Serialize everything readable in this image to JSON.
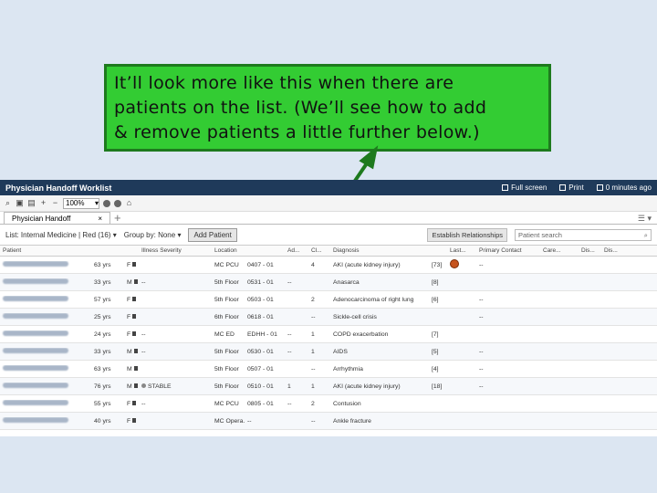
{
  "callout": {
    "lines": [
      "It’ll look more like this when there are",
      "patients on the list.  (We’ll see how to add",
      "& remove patients a little further below.)"
    ]
  },
  "app": {
    "title": "Physician Handoff Worklist",
    "actions": [
      {
        "label": "Full screen",
        "icon": "fullscreen-icon"
      },
      {
        "label": "Print",
        "icon": "print-icon"
      },
      {
        "label": "0 minutes ago",
        "icon": "refresh-icon"
      }
    ],
    "zoom": "100%",
    "tab_label": "Physician Handoff",
    "tab_close": "×",
    "filter_list": "List: Internal Medicine | Red (16)",
    "filter_group": "Group by: None",
    "add_patient": "Add Patient",
    "establish": "Establish Relationships",
    "search_placeholder": "Patient search",
    "columns": [
      "Patient",
      "",
      "",
      "Illness Severity",
      "Location",
      "",
      "Ad...",
      "Cl...",
      "Diagnosis",
      "",
      "Last...",
      "Primary Contact",
      "Care...",
      "Dis...",
      "Dis..."
    ],
    "rows": [
      {
        "age": "63 yrs",
        "sex": "F",
        "ill": "",
        "loc": "MC PCU",
        "room": "0407 - 01",
        "a": "",
        "b": "4",
        "diag": "AKI (acute kidney injury)",
        "cnt": "[73]",
        "badge": true,
        "prim": "--"
      },
      {
        "age": "33 yrs",
        "sex": "M",
        "ill": "--",
        "loc": "5th Floor",
        "room": "0531 - 01",
        "a": "--",
        "b": "",
        "diag": "Anasarca",
        "cnt": "[8]",
        "badge": false,
        "prim": ""
      },
      {
        "age": "57 yrs",
        "sex": "F",
        "ill": "",
        "loc": "5th Floor",
        "room": "0503 - 01",
        "a": "",
        "b": "2",
        "diag": "Adenocarcinoma of right lung",
        "cnt": "[6]",
        "badge": false,
        "prim": "--"
      },
      {
        "age": "25 yrs",
        "sex": "F",
        "ill": "",
        "loc": "6th Floor",
        "room": "0618 - 01",
        "a": "",
        "b": "--",
        "diag": "Sickle-cell crisis",
        "cnt": "",
        "badge": false,
        "prim": "--"
      },
      {
        "age": "24 yrs",
        "sex": "F",
        "ill": "--",
        "loc": "MC ED",
        "room": "EDHH - 01",
        "a": "--",
        "b": "1",
        "diag": "COPD exacerbation",
        "cnt": "[7]",
        "badge": false,
        "prim": ""
      },
      {
        "age": "33 yrs",
        "sex": "M",
        "ill": "--",
        "loc": "5th Floor",
        "room": "0530 - 01",
        "a": "--",
        "b": "1",
        "diag": "AIDS",
        "cnt": "[5]",
        "badge": false,
        "prim": "--"
      },
      {
        "age": "63 yrs",
        "sex": "M",
        "ill": "",
        "loc": "5th Floor",
        "room": "0507 - 01",
        "a": "",
        "b": "--",
        "diag": "Arrhythmia",
        "cnt": "[4]",
        "badge": false,
        "prim": "--"
      },
      {
        "age": "76 yrs",
        "sex": "M",
        "ill": "STABLE",
        "loc": "5th Floor",
        "room": "0510 - 01",
        "a": "1",
        "b": "1",
        "diag": "AKI (acute kidney injury)",
        "cnt": "[18]",
        "badge": false,
        "prim": "--"
      },
      {
        "age": "55 yrs",
        "sex": "F",
        "ill": "--",
        "loc": "MC PCU",
        "room": "0805 - 01",
        "a": "--",
        "b": "2",
        "diag": "Contusion",
        "cnt": "",
        "badge": false,
        "prim": ""
      },
      {
        "age": "40 yrs",
        "sex": "F",
        "ill": "",
        "loc": "MC Opera...",
        "room": "--",
        "a": "",
        "b": "--",
        "diag": "Ankle fracture",
        "cnt": "",
        "badge": false,
        "prim": ""
      }
    ]
  }
}
